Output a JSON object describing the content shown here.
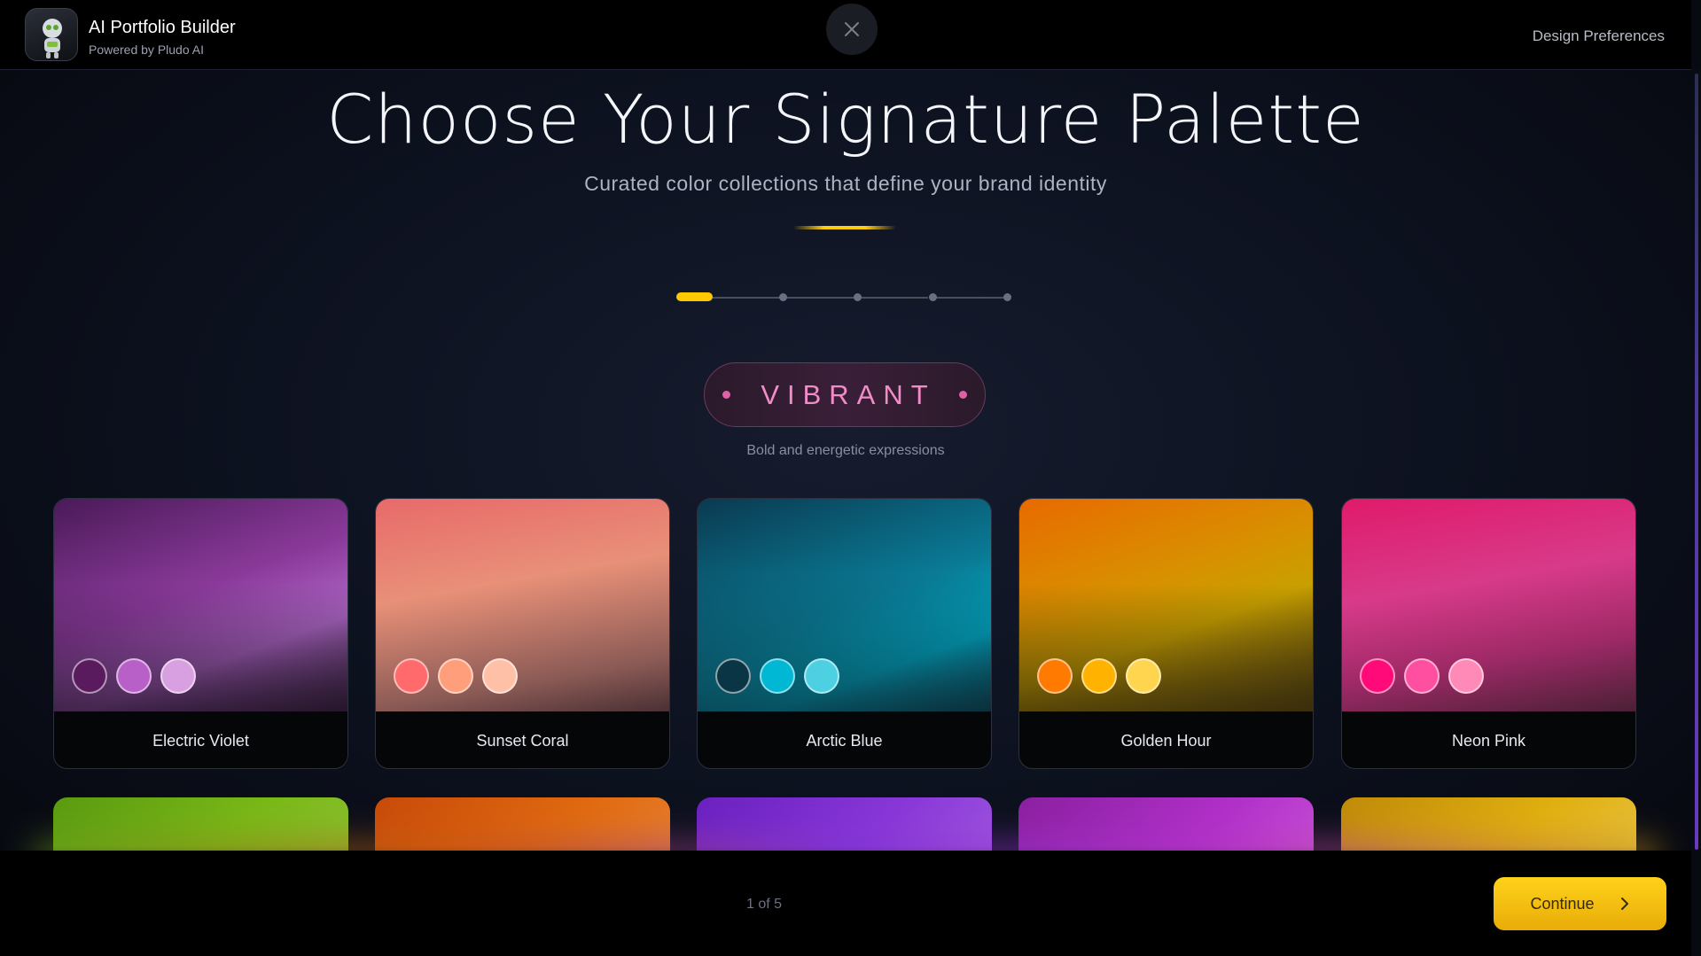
{
  "header": {
    "app_title": "AI Portfolio Builder",
    "app_subtitle": "Powered by Pludo AI",
    "right_link": "Design Preferences"
  },
  "main": {
    "title": "Choose Your Signature Palette",
    "subtitle": "Curated color collections that define your brand identity",
    "stepper": {
      "current_step": 1,
      "total_steps": 5
    },
    "category": {
      "name": "VIBRANT",
      "description": "Bold and energetic expressions"
    },
    "palettes": [
      {
        "name": "Electric Violet",
        "colors": [
          "#5a1a5e",
          "#b860c8",
          "#d8a0e0"
        ]
      },
      {
        "name": "Sunset Coral",
        "colors": [
          "#ff6b6b",
          "#ff9e7a",
          "#ffc0a8"
        ]
      },
      {
        "name": "Arctic Blue",
        "colors": [
          "#0a3545",
          "#00b8d4",
          "#4dd0e1"
        ]
      },
      {
        "name": "Golden Hour",
        "colors": [
          "#ff7a00",
          "#ffb300",
          "#ffd54f"
        ]
      },
      {
        "name": "Neon Pink",
        "colors": [
          "#ff0a78",
          "#ff4fa0",
          "#ff8ab8"
        ]
      }
    ]
  },
  "footer": {
    "page_counter": "1 of 5",
    "continue_label": "Continue"
  },
  "colors": {
    "accent": "#ffc800",
    "vibrant_pink": "#f28cc8",
    "background": "#0d1220"
  }
}
